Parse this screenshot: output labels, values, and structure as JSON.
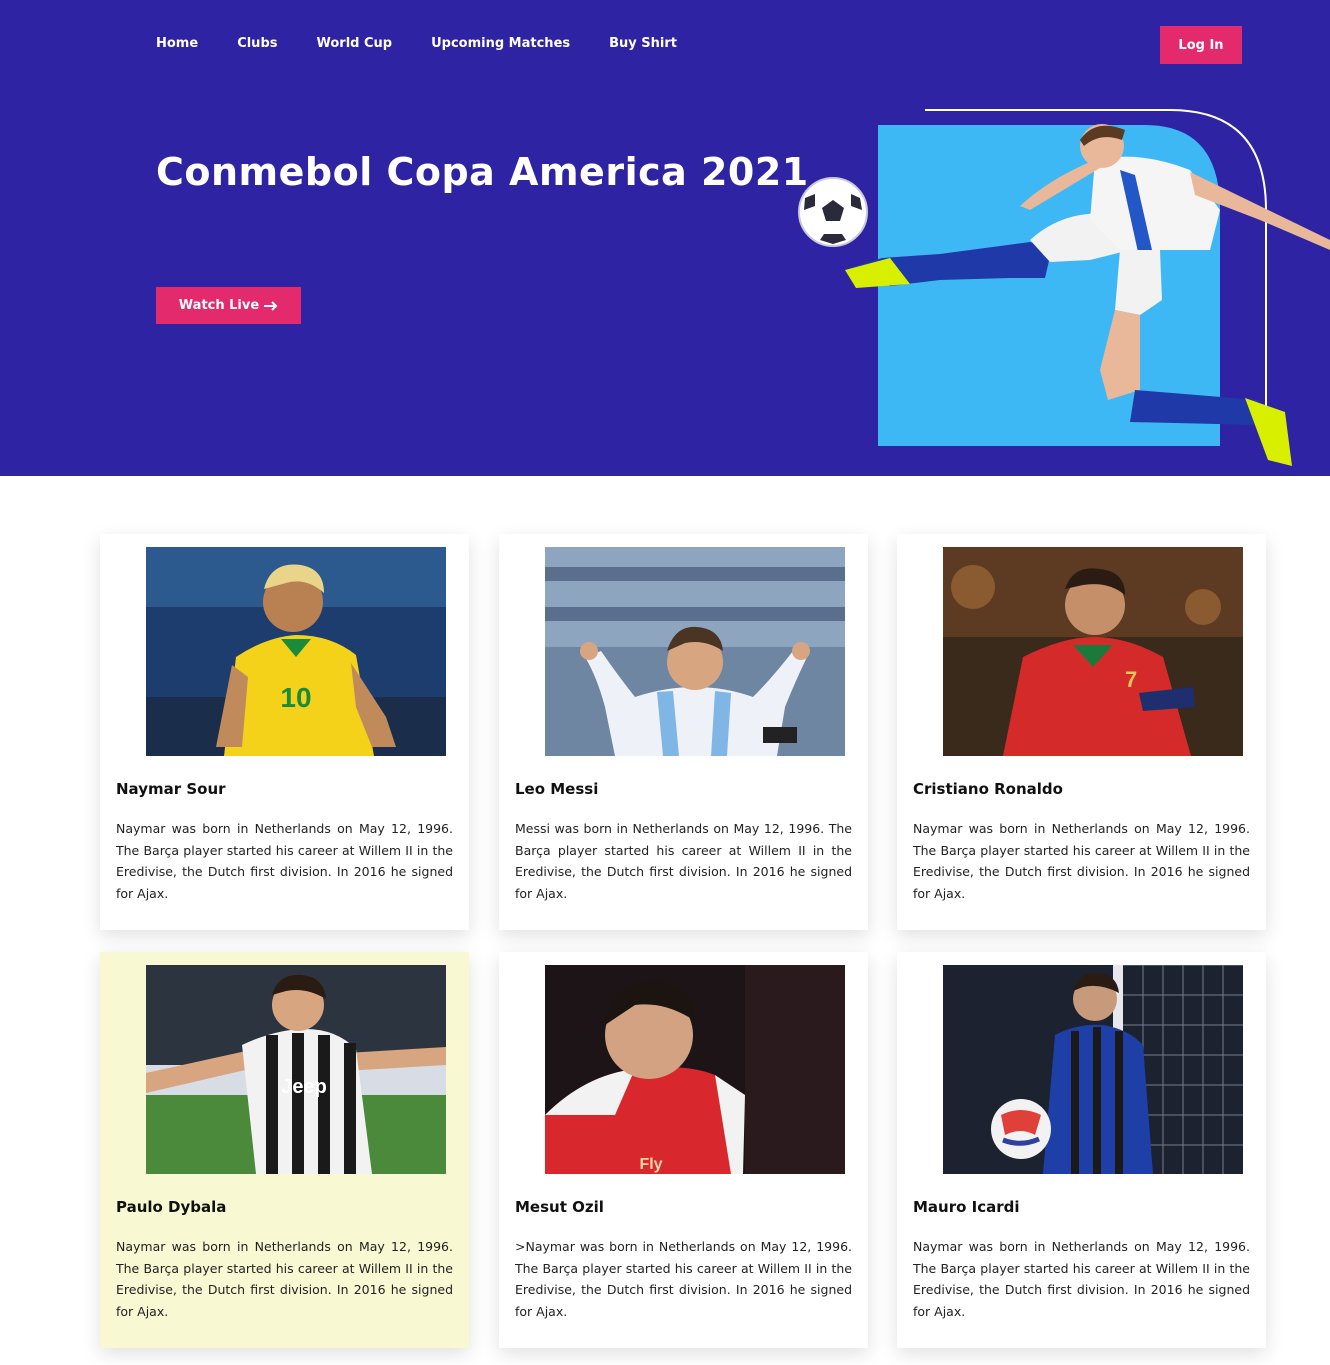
{
  "nav": {
    "items": [
      "Home",
      "Clubs",
      "World Cup",
      "Upcoming Matches",
      "Buy Shirt"
    ],
    "login_label": "Log In"
  },
  "hero": {
    "title": "Conmebol Copa America 2021",
    "watch_label": "Watch Live",
    "accent_color": "#e32a6d",
    "background_color": "#2e23a3",
    "panel_color": "#3db8f5"
  },
  "players": [
    {
      "name": "Naymar Sour",
      "bio": "Naymar was born in Netherlands on May 12, 1996. The Barça player started his career at Willem II in the Eredivise, the Dutch first division. In 2016 he signed for Ajax."
    },
    {
      "name": "Leo Messi",
      "bio": "Messi was born in Netherlands on May 12, 1996. The Barça player started his career at Willem II in the Eredivise, the Dutch first division. In 2016 he signed for Ajax."
    },
    {
      "name": "Cristiano Ronaldo",
      "bio": "Naymar was born in Netherlands on May 12, 1996. The Barça player started his career at Willem II in the Eredivise, the Dutch first division. In 2016 he signed for Ajax."
    },
    {
      "name": "Paulo Dybala",
      "bio": "Naymar was born in Netherlands on May 12, 1996. The Barça player started his career at Willem II in the Eredivise, the Dutch first division. In 2016 he signed for Ajax."
    },
    {
      "name": "Mesut Ozil",
      "bio": ">Naymar was born in Netherlands on May 12, 1996. The Barça player started his career at Willem II in the Eredivise, the Dutch first division. In 2016 he signed for Ajax."
    },
    {
      "name": "Mauro Icardi",
      "bio": "Naymar was born in Netherlands on May 12, 1996. The Barça player started his career at Willem II in the Eredivise, the Dutch first division. In 2016 he signed for Ajax."
    }
  ]
}
